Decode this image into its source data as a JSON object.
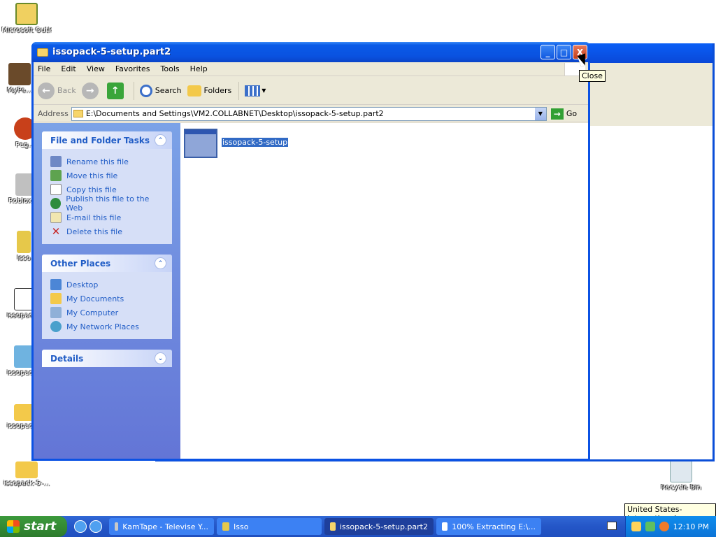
{
  "desktop_icons": [
    {
      "label": "Microsoft Outlook",
      "color": "#f0d060"
    },
    {
      "label": "MyPe...",
      "color": "#6a4a2a"
    },
    {
      "label": "Peg...",
      "color": "#c8401a"
    },
    {
      "label": "RobloxPl...",
      "color": "#c0c0c0"
    },
    {
      "label": "Isso",
      "color": "#e6c84a"
    },
    {
      "label": "issopack...",
      "color": "#ffffff"
    },
    {
      "label": "issopack...",
      "color": "#6fb3e0"
    },
    {
      "label": "issopack...",
      "color": "#f3c94a"
    },
    {
      "label": "issopack-5-...",
      "color": "#f3c94a"
    },
    {
      "label": "Recycle Bin",
      "color": "#9ed36a"
    }
  ],
  "window": {
    "title": "issopack-5-setup.part2",
    "buttons": {
      "minimize": "_",
      "maximize": "□",
      "close": "X"
    },
    "menu": [
      "File",
      "Edit",
      "View",
      "Favorites",
      "Tools",
      "Help"
    ],
    "toolbar": {
      "back": "Back",
      "forward_symbol": "→",
      "back_symbol": "←",
      "up_symbol": "↑",
      "search": "Search",
      "folders": "Folders"
    },
    "address": {
      "label": "Address",
      "value": "E:\\Documents and Settings\\VM2.COLLABNET\\Desktop\\issopack-5-setup.part2",
      "go": "Go"
    },
    "left_pane": {
      "file_tasks": {
        "title": "File and Folder Tasks",
        "items": [
          "Rename this file",
          "Move this file",
          "Copy this file",
          "Publish this file to the Web",
          "E-mail this file",
          "Delete this file"
        ]
      },
      "other_places": {
        "title": "Other Places",
        "items": [
          "Desktop",
          "My Documents",
          "My Computer",
          "My Network Places"
        ]
      },
      "details": {
        "title": "Details"
      }
    },
    "files": [
      {
        "name": "issopack-5-setup"
      }
    ]
  },
  "tooltip": "Close",
  "keyboard_tooltip": "United States-International",
  "taskbar": {
    "start": "start",
    "buttons": [
      {
        "label": "KamTape - Televise Y...",
        "active": false
      },
      {
        "label": "Isso",
        "active": false
      },
      {
        "label": "issopack-5-setup.part2",
        "active": true
      },
      {
        "label": "100% Extracting E:\\...",
        "active": false
      }
    ],
    "clock": "12:10 PM"
  }
}
